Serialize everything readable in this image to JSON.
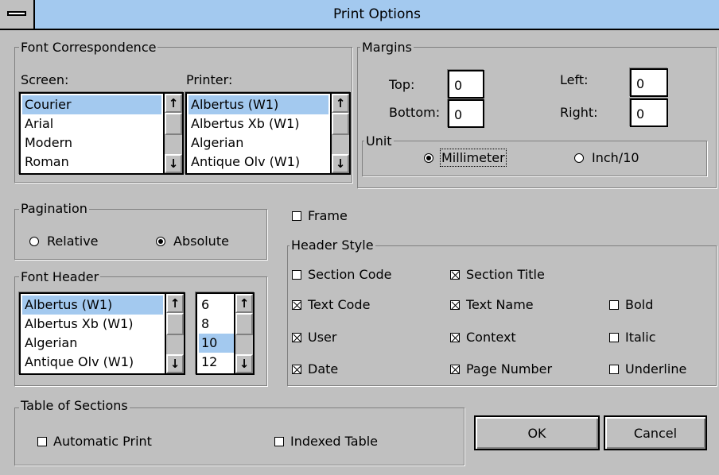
{
  "window": {
    "title": "Print Options"
  },
  "font_correspondence": {
    "group_label": "Font Correspondence",
    "screen_label": "Screen:",
    "printer_label": "Printer:",
    "screen_fonts": [
      "Courier",
      "Arial",
      "Modern",
      "Roman"
    ],
    "screen_selected": "Courier",
    "printer_fonts": [
      "Albertus (W1)",
      "Albertus Xb (W1)",
      "Algerian",
      "Antique Olv (W1)"
    ],
    "printer_selected": "Albertus (W1)"
  },
  "margins": {
    "group_label": "Margins",
    "top_label": "Top:",
    "top_value": "0",
    "bottom_label": "Bottom:",
    "bottom_value": "0",
    "left_label": "Left:",
    "left_value": "0",
    "right_label": "Right:",
    "right_value": "0",
    "unit": {
      "group_label": "Unit",
      "millimeter_label": "Millimeter",
      "inch_label": "Inch/10",
      "selected": "Millimeter"
    }
  },
  "pagination": {
    "group_label": "Pagination",
    "relative_label": "Relative",
    "absolute_label": "Absolute",
    "selected": "Absolute"
  },
  "font_header": {
    "group_label": "Font Header",
    "fonts": [
      "Albertus (W1)",
      "Albertus Xb (W1)",
      "Algerian",
      "Antique Olv (W1)"
    ],
    "font_selected": "Albertus (W1)",
    "sizes": [
      "6",
      "8",
      "10",
      "12"
    ],
    "size_selected": "10"
  },
  "frame": {
    "label": "Frame",
    "checked": false
  },
  "header_style": {
    "group_label": "Header Style",
    "options": {
      "section_code": {
        "label": "Section Code",
        "checked": false
      },
      "section_title": {
        "label": "Section Title",
        "checked": true
      },
      "text_code": {
        "label": "Text Code",
        "checked": true
      },
      "text_name": {
        "label": "Text Name",
        "checked": true
      },
      "bold": {
        "label": "Bold",
        "checked": false
      },
      "user": {
        "label": "User",
        "checked": true
      },
      "context": {
        "label": "Context",
        "checked": true
      },
      "italic": {
        "label": "Italic",
        "checked": false
      },
      "date": {
        "label": "Date",
        "checked": true
      },
      "page_number": {
        "label": "Page Number",
        "checked": true
      },
      "underline": {
        "label": "Underline",
        "checked": false
      }
    }
  },
  "table_of_sections": {
    "group_label": "Table of Sections",
    "automatic_print": {
      "label": "Automatic Print",
      "checked": false
    },
    "indexed_table": {
      "label": "Indexed Table",
      "checked": false
    }
  },
  "buttons": {
    "ok": "OK",
    "cancel": "Cancel"
  },
  "icons": {
    "system_menu": "system-menu-icon",
    "scroll_up": "up-arrow-icon",
    "scroll_down": "down-arrow-icon",
    "radio": "radio-icon",
    "checkbox": "checkbox-icon"
  }
}
